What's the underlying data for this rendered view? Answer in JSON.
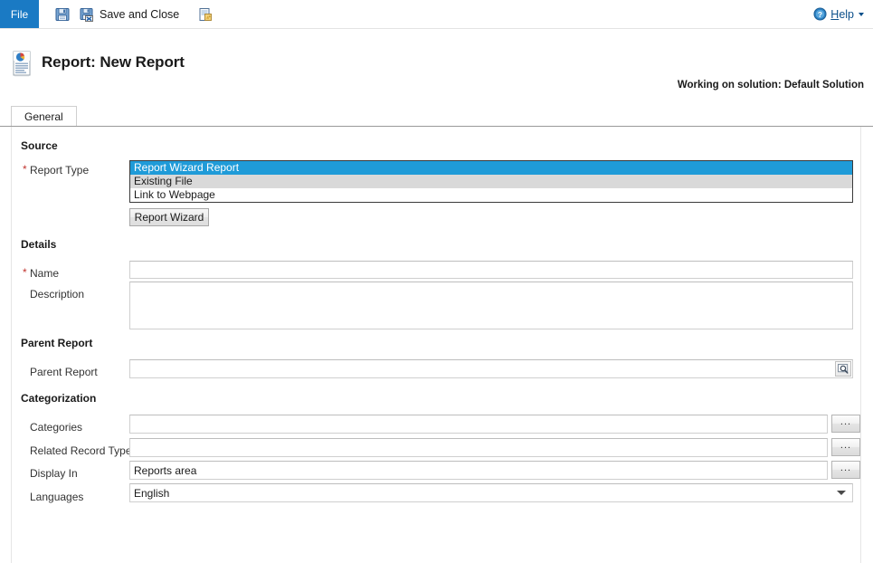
{
  "ribbon": {
    "file_tab": "File",
    "commands": [
      {
        "label": "",
        "icon": "save-icon",
        "name": "save-button"
      },
      {
        "label": "Save and Close",
        "icon": "save-and-close-icon",
        "name": "save-and-close-button"
      },
      {
        "label": "",
        "icon": "new-report-icon",
        "name": "new-button"
      }
    ],
    "help": {
      "label_prefix": "",
      "label_underlined": "H",
      "label_rest": "elp",
      "icon": "help-icon"
    }
  },
  "header": {
    "icon": "report-icon",
    "title": "Report: New Report",
    "solution": "Working on solution: Default Solution"
  },
  "tabs": [
    {
      "label": "General",
      "name": "tab-general",
      "selected": true
    }
  ],
  "form": {
    "sections": {
      "source": {
        "heading": "Source",
        "report_type": {
          "label": "Report Type",
          "required": true,
          "options": [
            "Report Wizard Report",
            "Existing File",
            "Link to Webpage"
          ],
          "selected": "Report Wizard Report"
        },
        "report_wizard_button": "Report Wizard"
      },
      "details": {
        "heading": "Details",
        "name": {
          "label": "Name",
          "required": true,
          "value": "",
          "placeholder": ""
        },
        "description": {
          "label": "Description",
          "required": false,
          "value": "",
          "placeholder": ""
        }
      },
      "parent_report": {
        "heading": "Parent Report",
        "parent_report": {
          "label": "Parent Report",
          "value": "",
          "placeholder": "",
          "lookup_icon": "lookup-icon"
        }
      },
      "categorization": {
        "heading": "Categorization",
        "categories": {
          "label": "Categories",
          "value": "",
          "button": "..."
        },
        "related_record_types": {
          "label": "Related Record Types",
          "value": "",
          "button": "..."
        },
        "display_in": {
          "label": "Display In",
          "value": "Reports area",
          "button": "..."
        },
        "languages": {
          "label": "Languages",
          "value": "English",
          "options": [
            "English"
          ]
        }
      }
    }
  },
  "colors": {
    "accent_blue": "#1a7ac4",
    "selection_blue": "#1f9bd8",
    "required_red": "#c1342f",
    "link_blue": "#0b4f8a"
  }
}
